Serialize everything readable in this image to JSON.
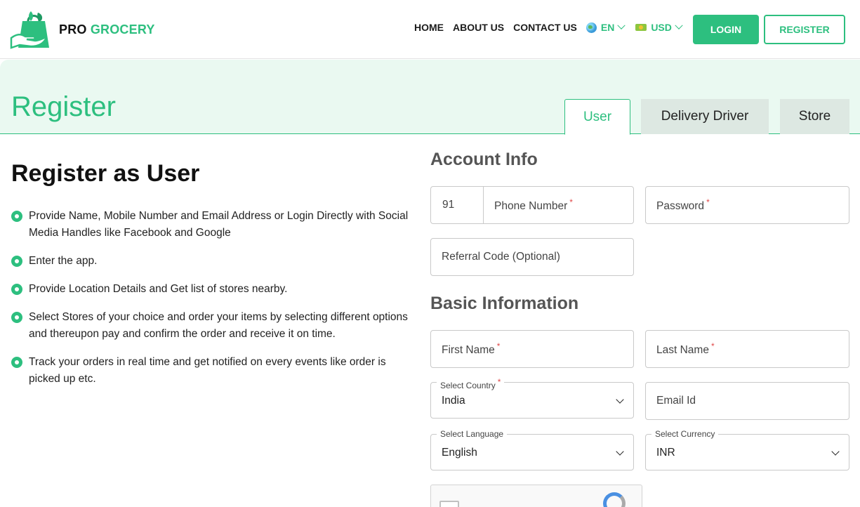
{
  "header": {
    "logo_word1": "PRO",
    "logo_word2": "GROCERY",
    "nav": [
      "HOME",
      "ABOUT US",
      "CONTACT US"
    ],
    "language": {
      "icon": "globe-icon",
      "value": "EN"
    },
    "currency": {
      "icon": "money-icon",
      "value": "USD"
    },
    "login_label": "LOGIN",
    "register_label": "REGISTER"
  },
  "banner": {
    "title": "Register",
    "tabs": [
      "User",
      "Delivery Driver",
      "Store"
    ],
    "active_tab": "User"
  },
  "left": {
    "title": "Register as User",
    "steps": [
      "Provide Name, Mobile Number and Email Address or Login Directly with Social Media Handles like Facebook and Google",
      "Enter the app.",
      "Provide Location Details and Get list of stores nearby.",
      "Select Stores of your choice and order your items by selecting different options and thereupon pay and confirm the order and receive it on time.",
      "Track your orders in real time and get notified on every events like order is picked up etc."
    ]
  },
  "form": {
    "account_title": "Account Info",
    "country_code": "91",
    "phone_placeholder": "Phone Number",
    "password_placeholder": "Password",
    "referral_placeholder": "Referral Code (Optional)",
    "basic_title": "Basic Information",
    "first_name_placeholder": "First Name",
    "last_name_placeholder": "Last Name",
    "country_label": "Select Country",
    "country_value": "India",
    "email_placeholder": "Email Id",
    "language_label": "Select Language",
    "language_value": "English",
    "currency_label": "Select Currency",
    "currency_value": "INR",
    "required_mark": "*"
  },
  "colors": {
    "brand": "#2dbf7f",
    "banner_bg": "#eaf9f1",
    "required": "#e04848"
  }
}
